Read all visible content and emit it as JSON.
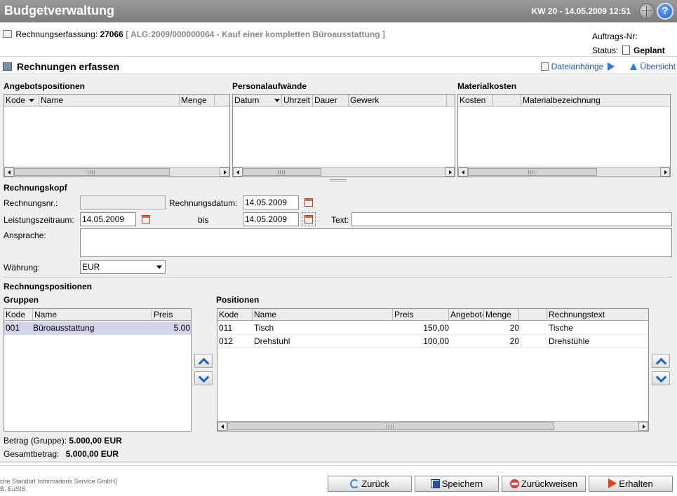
{
  "header": {
    "app_title": "Budgetverwaltung",
    "datetime": "KW 20 - 14.05.2009 12:51",
    "help_glyph": "?"
  },
  "info": {
    "label": "Rechnungserfassung:",
    "number": "27066",
    "reference": "[ ALG:2009/000000064 - Kauf einer kompletten Büroausstattung ]",
    "order_label": "Auftrags-Nr:",
    "status_label": "Status:",
    "status_value": "Geplant"
  },
  "page": {
    "title": "Rechnungen erfassen",
    "attachments_link": "Dateianhänge",
    "overview_link": "Übersicht"
  },
  "grids": {
    "offers": {
      "title": "Angebotspositionen",
      "columns": [
        "Kode",
        "Name",
        "Menge"
      ]
    },
    "personnel": {
      "title": "Personalaufwände",
      "columns": [
        "Datum",
        "Uhrzeit",
        "Dauer",
        "Gewerk"
      ]
    },
    "material": {
      "title": "Materialkosten",
      "columns": [
        "Kosten",
        "",
        "Materialbezeichnung"
      ]
    }
  },
  "invoice_head": {
    "title": "Rechnungskopf",
    "invoice_no_label": "Rechnungsnr.:",
    "invoice_no_value": "",
    "invoice_date_label": "Rechnungsdatum:",
    "invoice_date_value": "14.05.2009",
    "period_label": "Leistungszeitraum:",
    "period_from": "14.05.2009",
    "to_label": "bis",
    "period_to": "14.05.2009",
    "text_label": "Text:",
    "text_value": "",
    "salutation_label": "Ansprache:",
    "salutation_value": "",
    "currency_label": "Währung:",
    "currency_value": "EUR"
  },
  "positions": {
    "title": "Rechnungspositionen",
    "groups": {
      "title": "Gruppen",
      "columns": [
        "Kode",
        "Name",
        "Preis"
      ],
      "rows": [
        {
          "code": "001",
          "name": "Büroausstattung",
          "price": "5.00"
        }
      ]
    },
    "items": {
      "title": "Positionen",
      "columns": [
        "Kode",
        "Name",
        "Preis",
        "Angebot-",
        "Menge",
        "",
        "Rechnungstext"
      ],
      "rows": [
        {
          "code": "011",
          "name": "Tisch",
          "price": "150,00",
          "qty": "20",
          "text": "Tische"
        },
        {
          "code": "012",
          "name": "Drehstuhl",
          "price": "100,00",
          "qty": "20",
          "text": "Drehstühle"
        }
      ]
    },
    "group_amount_label": "Betrag (Gruppe):",
    "group_amount_value": "5.000,00 EUR",
    "total_label": "Gesamtbetrag:",
    "total_value": "5.000,00 EUR"
  },
  "footer": {
    "line1": "che Standort Informations Service GmbH]",
    "line2": "B, EuSIS",
    "buttons": {
      "back": "Zurück",
      "save": "Speichern",
      "reject": "Zurückweisen",
      "submit": "Erhalten"
    }
  }
}
